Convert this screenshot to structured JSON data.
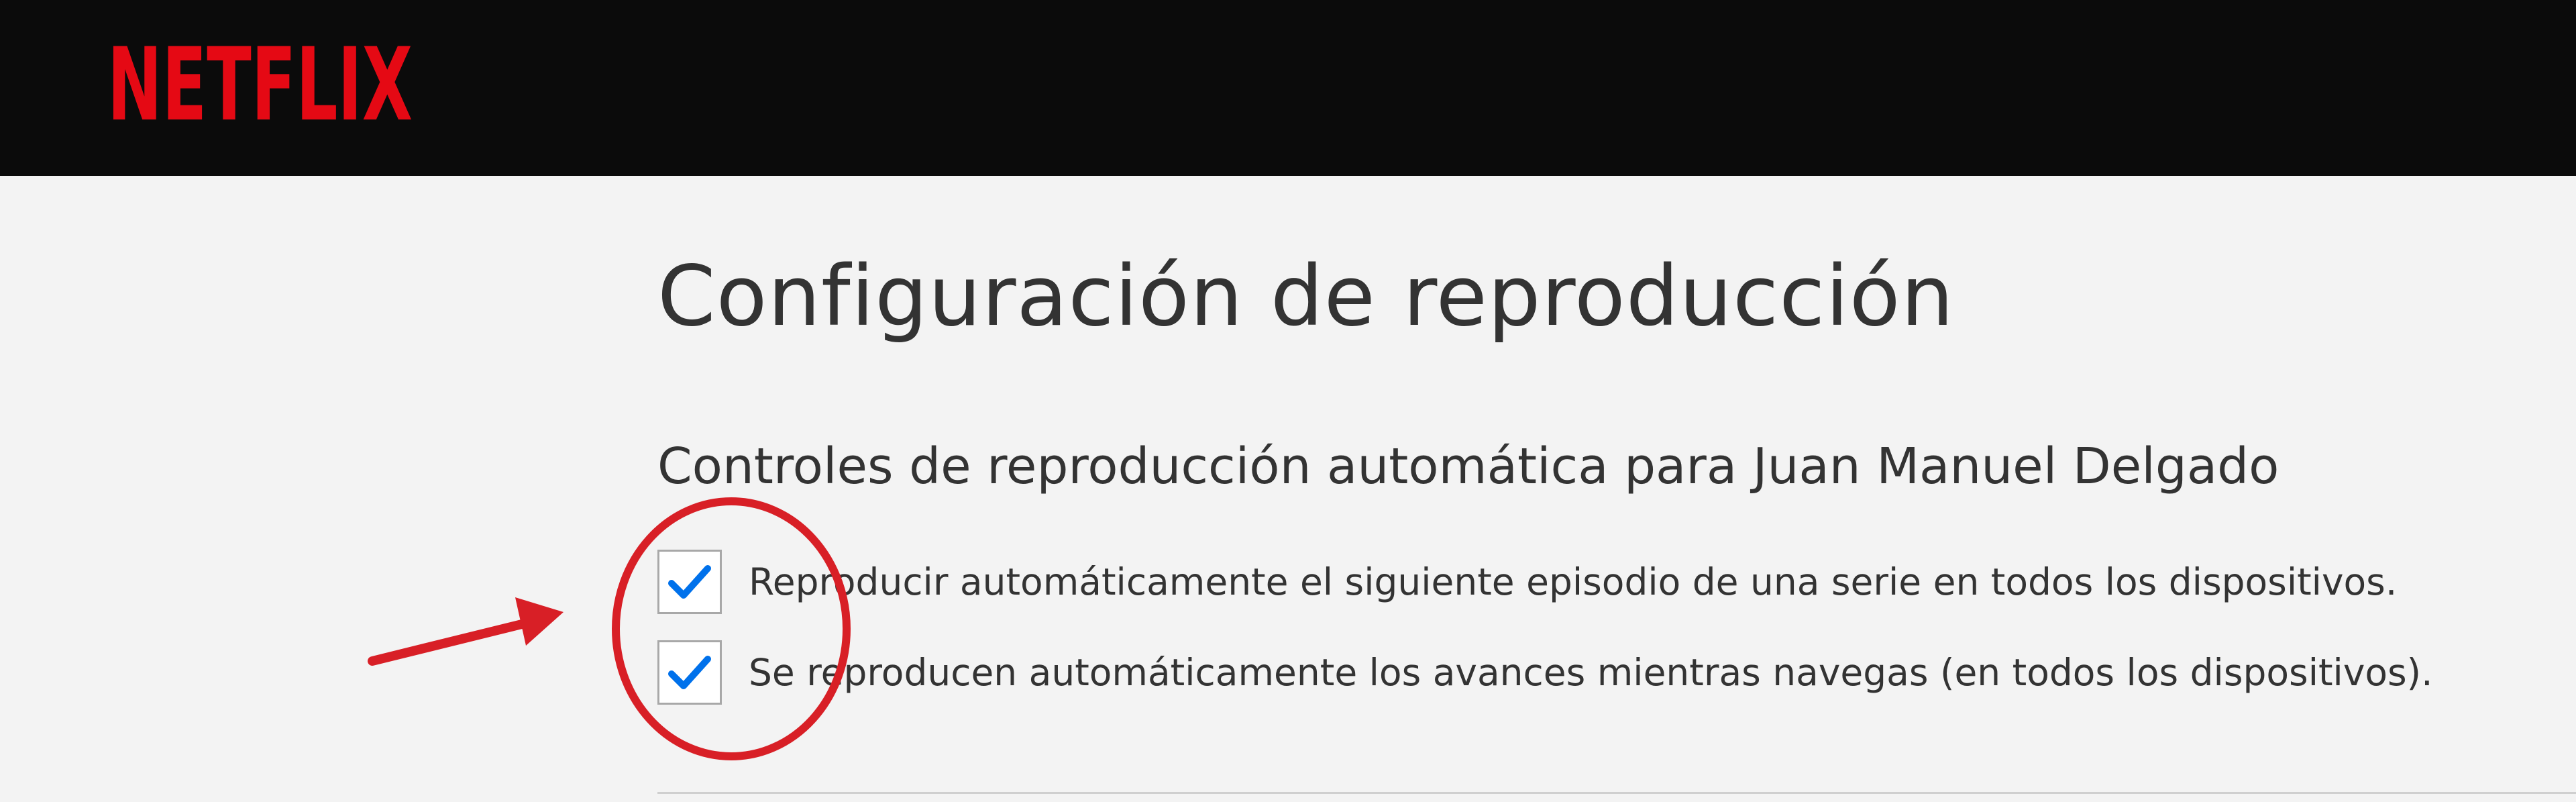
{
  "brand": {
    "name": "NETFLIX",
    "color": "#e50914"
  },
  "page": {
    "title": "Configuración de reproducción"
  },
  "autoplay": {
    "heading": "Controles de reproducción automática para Juan Manuel Delgado",
    "options": [
      {
        "label": "Reproducir automáticamente el siguiente episodio de una serie en todos los dispositivos.",
        "checked": true
      },
      {
        "label": "Se reproducen automáticamente los avances mientras navegas (en todos los dispositivos).",
        "checked": true
      }
    ]
  },
  "annotation": {
    "color": "#d81f26",
    "arrow": "arrow-icon",
    "circle": "circle-highlight"
  },
  "colors": {
    "checkmark": "#0071eb",
    "header_bg": "#0b0b0b",
    "page_bg": "#f3f3f3"
  }
}
